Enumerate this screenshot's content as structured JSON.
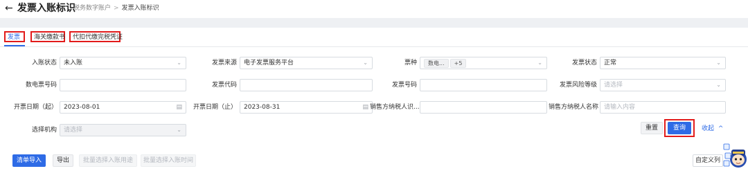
{
  "header": {
    "title": "发票入账标识",
    "breadcrumb": [
      "税务数字账户",
      "发票入账标识"
    ]
  },
  "tabs": [
    {
      "label": "发票",
      "active": true
    },
    {
      "label": "海关缴款书",
      "active": false
    },
    {
      "label": "代扣代缴完税凭证",
      "active": false
    }
  ],
  "form": {
    "row1": {
      "entry_status": {
        "label": "入账状态",
        "value": "未入账"
      },
      "invoice_source": {
        "label": "发票来源",
        "value": "电子发票服务平台"
      },
      "ticket_type": {
        "label": "票种",
        "tags": [
          "数电...",
          "+5"
        ]
      },
      "invoice_status": {
        "label": "发票状态",
        "value": "正常"
      }
    },
    "row2": {
      "digital_number": {
        "label": "数电票号码",
        "value": ""
      },
      "invoice_code": {
        "label": "发票代码",
        "value": ""
      },
      "invoice_number": {
        "label": "发票号码",
        "value": ""
      },
      "risk_level": {
        "label": "发票风险等级",
        "placeholder": "请选择"
      }
    },
    "row3": {
      "date_start": {
        "label": "开票日期（起）",
        "value": "2023-08-01"
      },
      "date_end": {
        "label": "开票日期（止）",
        "value": "2023-08-31"
      },
      "seller_tax_id": {
        "label": "销售方纳税人识...",
        "value": ""
      },
      "seller_name": {
        "label": "销售方纳税人名称",
        "placeholder": "请输入内容"
      }
    },
    "row4": {
      "org": {
        "label": "选择机构",
        "placeholder": "请选择"
      }
    }
  },
  "actions": {
    "reset": "重置",
    "query": "查询",
    "collapse": "收起",
    "collapse_icon": "^"
  },
  "toolbar": {
    "import_list": "清单导入",
    "export": "导出",
    "batch_purpose": "批量选择入账用途",
    "batch_time": "批量选择入账时间",
    "custom_columns": "自定义列"
  },
  "colors": {
    "primary": "#2e6be6",
    "highlight": "#e21b1b"
  }
}
